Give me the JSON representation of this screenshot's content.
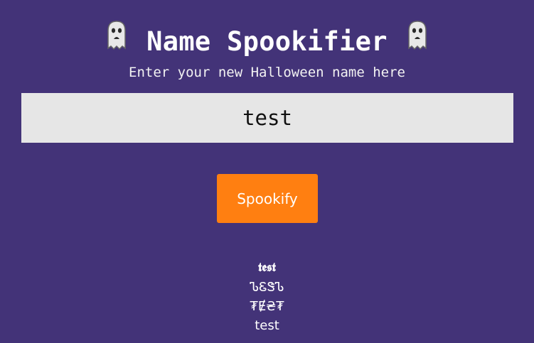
{
  "header": {
    "title": "Name Spookifier",
    "left_icon": "ghost-icon",
    "right_icon": "ghost-icon"
  },
  "subtitle": "Enter your new Halloween name here",
  "name_input": {
    "value": "test"
  },
  "spookify_button": {
    "label": "Spookify"
  },
  "results": [
    "𝖙𝖊𝖘𝖙",
    "ᏖᏋᏕᏖ",
    "₮Ɇ₴₮",
    "test"
  ],
  "colors": {
    "background": "#433378",
    "input_background": "#e6e6e6",
    "button": "#ff7f11",
    "text": "#ffffff"
  }
}
